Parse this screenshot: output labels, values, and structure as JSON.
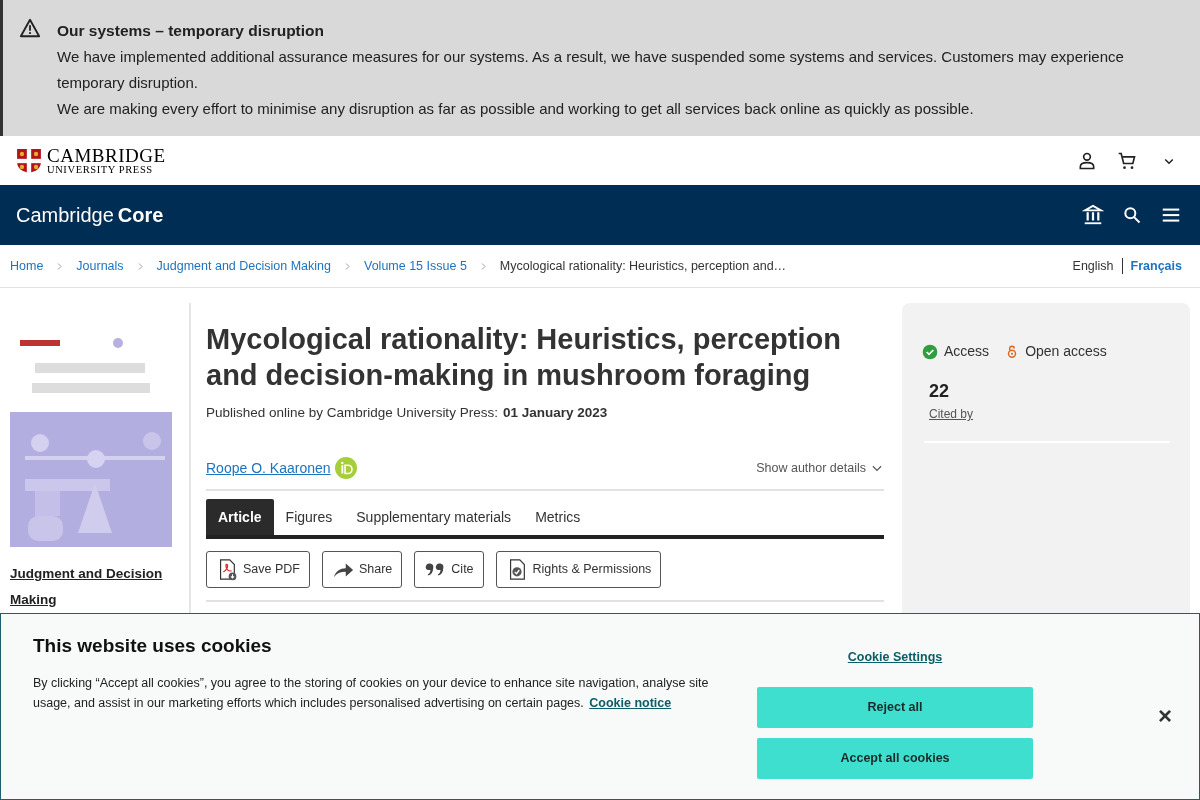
{
  "alert": {
    "title": "Our systems – temporary disruption",
    "paragraphs": [
      "We have implemented additional assurance measures for our systems. As a result, we have suspended some systems and services. Customers may experience temporary disruption.",
      "We are making every effort to minimise any disruption as far as possible and working to get all services back online as quickly as possible."
    ]
  },
  "header": {
    "logo_line_1": "CAMBRIDGE",
    "logo_line_2": "UNIVERSITY PRESS"
  },
  "nav": {
    "brand_light": "Cambridge",
    "brand_bold": "Core"
  },
  "breadcrumbs": [
    "Home",
    "Journals",
    "Judgment and Decision Making",
    "Volume 15 Issue 5",
    "Mycological rationality: Heuristics, perception and…"
  ],
  "languages": [
    {
      "label": "English",
      "selected": false
    },
    {
      "label": "Français",
      "selected": true
    }
  ],
  "journal": {
    "name": "Judgment and Decision Making"
  },
  "article": {
    "title": "Mycological rationality: Heuristics, perception and decision-making in mushroom foraging",
    "published_label": "Published online by Cambridge University Press:",
    "published_date": "01 January 2023",
    "author": "Roope O. Kaaronen",
    "author_details": "Show author details",
    "tabs": [
      {
        "label": "Article",
        "selected": true
      },
      {
        "label": "Figures",
        "selected": false
      },
      {
        "label": "Supplementary materials",
        "selected": false
      },
      {
        "label": "Metrics",
        "selected": false
      }
    ],
    "actions": [
      {
        "label": "Save PDF",
        "kind": "pdf"
      },
      {
        "label": "Share",
        "kind": "share"
      },
      {
        "label": "Cite",
        "kind": "cite"
      },
      {
        "label": "Rights & Permissions",
        "kind": "rights"
      }
    ]
  },
  "access_panel": {
    "access": "Access",
    "open_access": "Open access",
    "cited_count": "22",
    "cited_label": "Cited by"
  },
  "cookie_banner": {
    "title": "This website uses cookies",
    "text": "By clicking “Accept all cookies”, you agree to the storing of cookies on your device to enhance site navigation, analyse site usage, and assist in our marketing efforts which includes personalised advertising on certain pages.",
    "notice_link": "Cookie notice",
    "settings_link": "Cookie Settings",
    "buttons": [
      "Reject all",
      "Accept all cookies"
    ],
    "close": "×"
  }
}
